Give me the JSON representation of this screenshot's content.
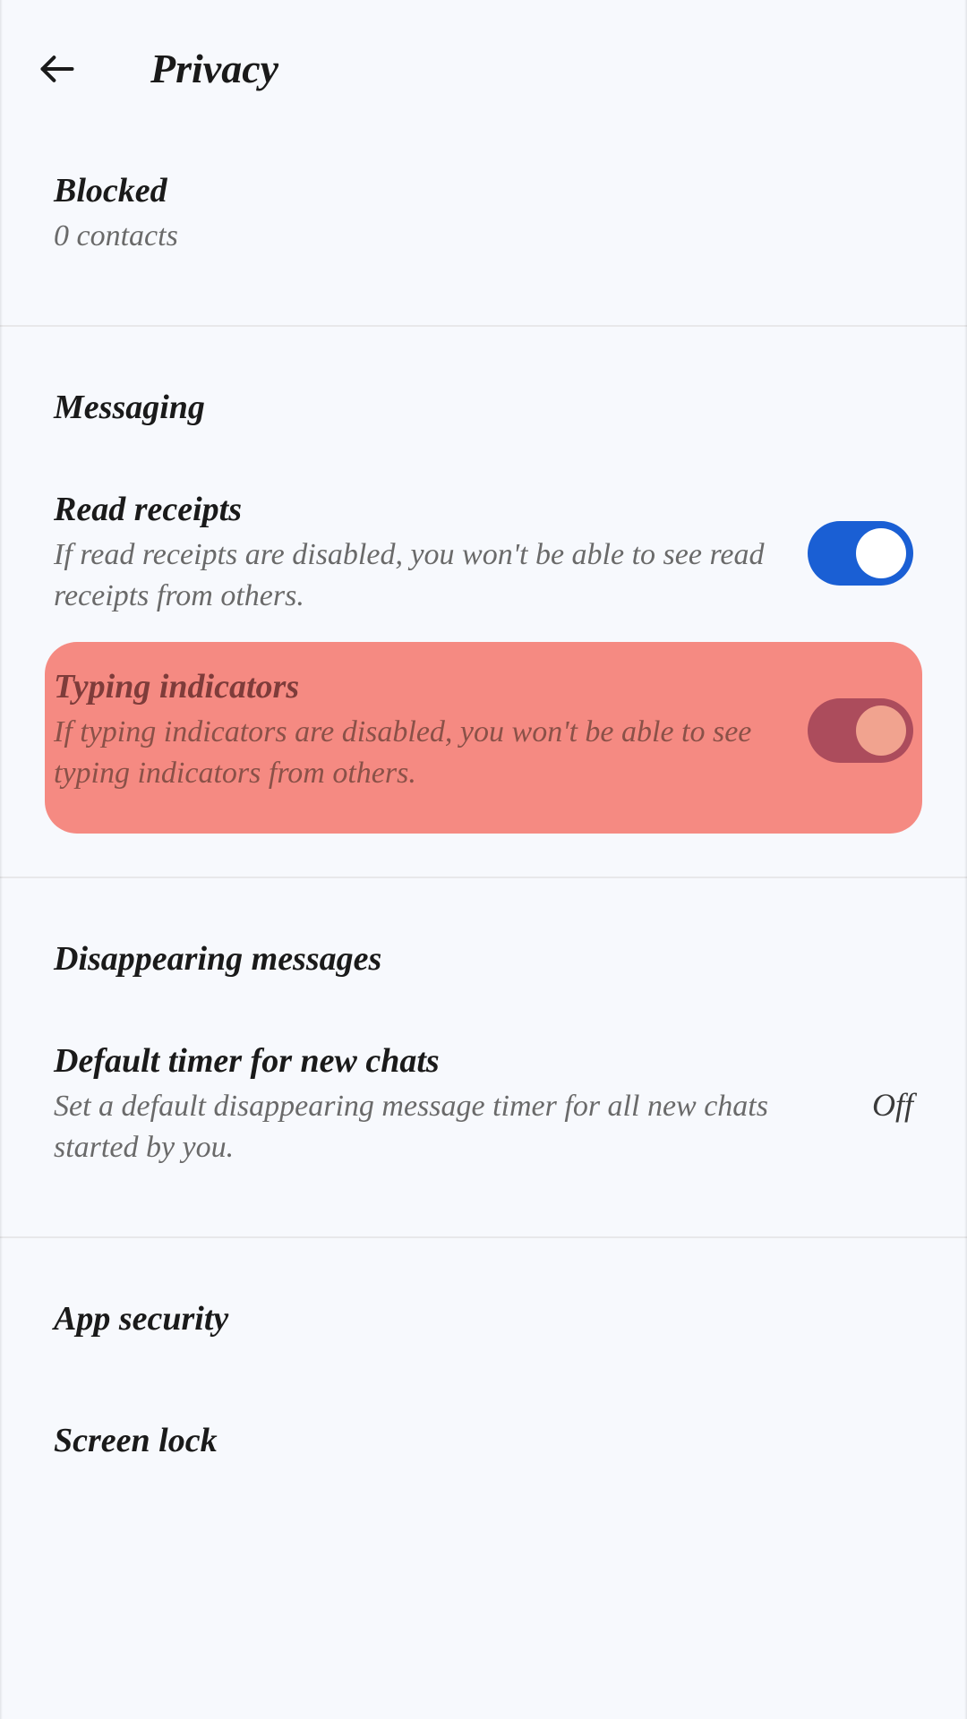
{
  "header": {
    "title": "Privacy"
  },
  "blocked": {
    "title": "Blocked",
    "subtitle": "0 contacts"
  },
  "messaging": {
    "section_title": "Messaging",
    "read_receipts": {
      "title": "Read receipts",
      "desc": "If read receipts are disabled, you won't be able to see read receipts from others."
    },
    "typing_indicators": {
      "title": "Typing indicators",
      "desc": "If typing indicators are disabled, you won't be able to see typing indicators from others."
    }
  },
  "disappearing": {
    "section_title": "Disappearing messages",
    "default_timer": {
      "title": "Default timer for new chats",
      "desc": "Set a default disappearing message timer for all new chats started by you.",
      "value": "Off"
    }
  },
  "app_security": {
    "section_title": "App security",
    "screen_lock": {
      "title": "Screen lock"
    }
  }
}
